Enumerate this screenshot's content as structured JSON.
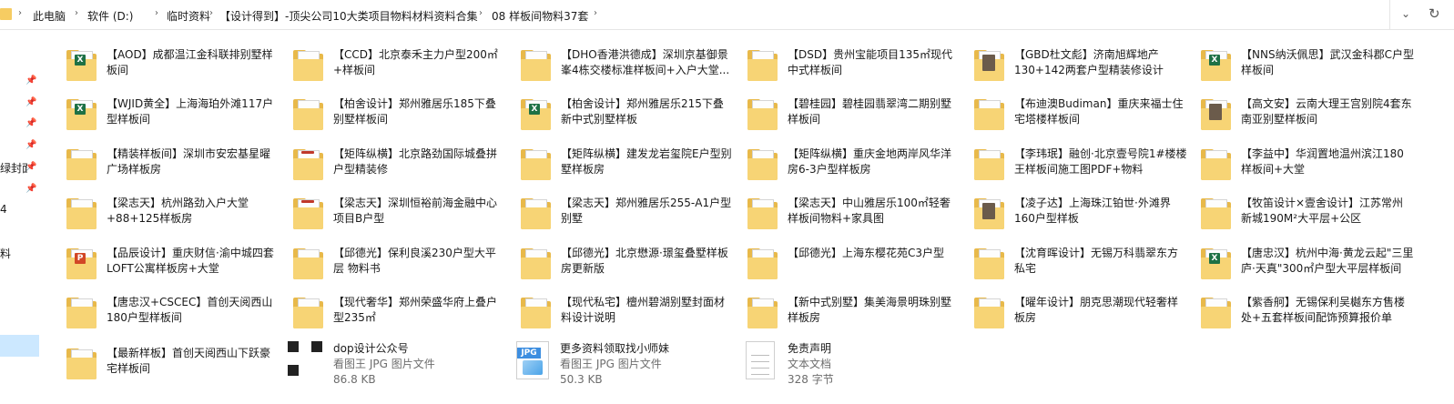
{
  "breadcrumb": {
    "items": [
      "此电脑",
      "软件 (D:)",
      "临时资料",
      "【设计得到】-顶尖公司10大类项目物料材料资料合集",
      "08 样板间物料37套"
    ]
  },
  "nav": {
    "texts": [
      "绿封面",
      "4",
      "料"
    ]
  },
  "items": [
    {
      "name": "【AOD】成都温江金科联排别墅样板间",
      "icon": "folder",
      "badge": "xls"
    },
    {
      "name": "【CCD】北京泰禾主力户型200㎡+样板间",
      "icon": "folder",
      "badge": ""
    },
    {
      "name": "【DHO香港洪德成】深圳京基御景峯4栋交楼标准样板间+入户大堂...",
      "icon": "folder",
      "badge": ""
    },
    {
      "name": "【DSD】贵州宝能项目135㎡现代中式样板间",
      "icon": "folder",
      "badge": ""
    },
    {
      "name": "【GBD杜文彪】济南旭辉地产130+142两套户型精装修设计",
      "icon": "folder",
      "badge": "img"
    },
    {
      "name": "【NNS纳沃佩思】武汉金科郡C户型样板间",
      "icon": "folder",
      "badge": "xls"
    },
    {
      "name": "【WJID黄全】上海海珀外滩117户型样板间",
      "icon": "folder",
      "badge": "xls"
    },
    {
      "name": "【柏舍设计】郑州雅居乐185下叠别墅样板间",
      "icon": "folder",
      "badge": ""
    },
    {
      "name": "【柏舍设计】郑州雅居乐215下叠新中式别墅样板",
      "icon": "folder",
      "badge": "xls"
    },
    {
      "name": "【碧桂园】碧桂园翡翠湾二期别墅样板间",
      "icon": "folder",
      "badge": ""
    },
    {
      "name": "【布迪澳Budiman】重庆来福士住宅塔楼样板间",
      "icon": "folder",
      "badge": ""
    },
    {
      "name": "【高文安】云南大理王宫别院4套东南亚别墅样板间",
      "icon": "folder",
      "badge": "img"
    },
    {
      "name": "【精装样板间】深圳市安宏基星曜广场样板房",
      "icon": "folder",
      "badge": ""
    },
    {
      "name": "【矩阵纵横】北京路劲国际城叠拼户型精装修",
      "icon": "folder",
      "badge": "red"
    },
    {
      "name": "【矩阵纵横】建发龙岩玺院E户型别墅样板房",
      "icon": "folder",
      "badge": ""
    },
    {
      "name": "【矩阵纵横】重庆金地两岸风华洋房6-3户型样板房",
      "icon": "folder",
      "badge": ""
    },
    {
      "name": "【李玮珉】融创·北京壹号院1#楼楼王样板间施工图PDF+物料",
      "icon": "folder",
      "badge": ""
    },
    {
      "name": "【李益中】华润置地温州滨江180样板间+大堂",
      "icon": "folder",
      "badge": ""
    },
    {
      "name": "【梁志天】杭州路劲入户大堂+88+125样板房",
      "icon": "folder",
      "badge": ""
    },
    {
      "name": "【梁志天】深圳恒裕前海金融中心项目B户型",
      "icon": "folder",
      "badge": "red"
    },
    {
      "name": "【梁志天】郑州雅居乐255-A1户型别墅",
      "icon": "folder",
      "badge": ""
    },
    {
      "name": "【梁志天】中山雅居乐100㎡轻奢样板间物料+家具图",
      "icon": "folder",
      "badge": ""
    },
    {
      "name": "【凌子达】上海珠江铂世·外滩界160户型样板",
      "icon": "folder",
      "badge": "img"
    },
    {
      "name": "【牧笛设计×壹舍设计】江苏常州新城190M²大平层+公区",
      "icon": "folder",
      "badge": ""
    },
    {
      "name": "【品辰设计】重庆财信·渝中城四套LOFT公寓样板房+大堂",
      "icon": "folder",
      "badge": "ppt"
    },
    {
      "name": "【邱德光】保利良溪230户型大平层 物料书",
      "icon": "folder",
      "badge": ""
    },
    {
      "name": "【邱德光】北京懋源·璟玺叠墅样板房更新版",
      "icon": "folder",
      "badge": ""
    },
    {
      "name": "【邱德光】上海东樱花苑C3户型",
      "icon": "folder",
      "badge": ""
    },
    {
      "name": "【沈育晖设计】无锡万科翡翠东方私宅",
      "icon": "folder",
      "badge": ""
    },
    {
      "name": "【唐忠汉】杭州中海·黄龙云起\"三里庐·天真\"300㎡户型大平层样板间",
      "icon": "folder",
      "badge": "xls"
    },
    {
      "name": "【唐忠汉+CSCEC】首创天阅西山180户型样板间",
      "icon": "folder",
      "badge": ""
    },
    {
      "name": "【现代奢华】郑州荣盛华府上叠户型235㎡",
      "icon": "folder",
      "badge": ""
    },
    {
      "name": "【现代私宅】檀州碧湖别墅封面材料设计说明",
      "icon": "folder",
      "badge": ""
    },
    {
      "name": "【新中式别墅】集美海景明珠别墅样板房",
      "icon": "folder",
      "badge": ""
    },
    {
      "name": "【曜年设计】朋克思潮现代轻奢样板房",
      "icon": "folder",
      "badge": ""
    },
    {
      "name": "【紫香舸】无锡保利吴樾东方售楼处+五套样板间配饰预算报价单",
      "icon": "folder",
      "badge": ""
    },
    {
      "name": "【最新样板】首创天阅西山下跃豪宅样板间",
      "icon": "folder",
      "badge": ""
    }
  ],
  "files": [
    {
      "name": "dop设计公众号",
      "type": "看图王 JPG 图片文件",
      "size": "86.8 KB",
      "icon": "qr-icon"
    },
    {
      "name": "更多资料领取找小师妹",
      "type": "看图王 JPG 图片文件",
      "size": "50.3 KB",
      "icon": "jpg-icon",
      "tag": "JPG"
    },
    {
      "name": "免责声明",
      "type": "文本文档",
      "size": "328 字节",
      "icon": "text-file-icon"
    }
  ]
}
